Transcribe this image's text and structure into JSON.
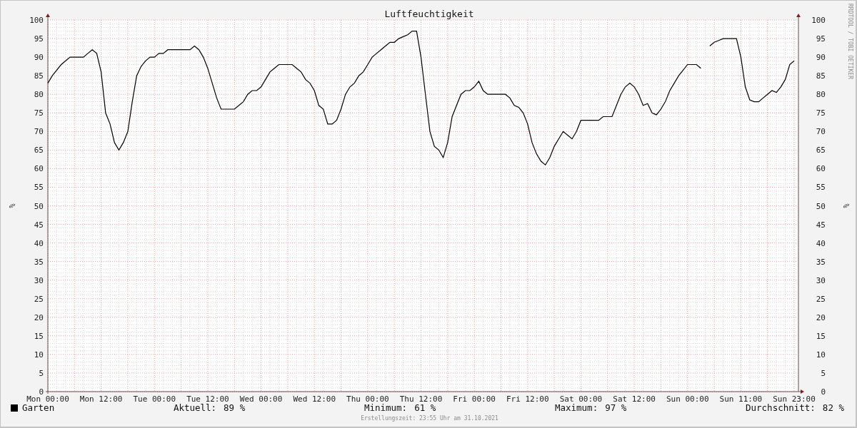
{
  "chart": {
    "credit": "RRDTOOL / TOBI OETIKER",
    "right_axis": {
      "label": "%",
      "ticks": [
        "100",
        "95",
        "90",
        "85",
        "80",
        "75",
        "70",
        "65",
        "60",
        "55",
        "50",
        "45",
        "40",
        "35",
        "30",
        "25",
        "20",
        "15",
        "10",
        "5",
        "0"
      ]
    },
    "chart_data": {
      "type": "line",
      "title": "Luftfeuchtigkeit",
      "ylabel": "%",
      "grid": true,
      "ylim": [
        0,
        100
      ],
      "yticks": [
        0,
        5,
        10,
        15,
        20,
        25,
        30,
        35,
        40,
        45,
        50,
        55,
        60,
        65,
        70,
        75,
        80,
        85,
        90,
        95,
        100
      ],
      "categories": [
        "Mon 00:00",
        null,
        null,
        null,
        null,
        null,
        null,
        null,
        null,
        null,
        null,
        null,
        "Mon 12:00",
        null,
        null,
        null,
        null,
        null,
        null,
        null,
        null,
        null,
        null,
        null,
        "Tue 00:00",
        null,
        null,
        null,
        null,
        null,
        null,
        null,
        null,
        null,
        null,
        null,
        "Tue 12:00",
        null,
        null,
        null,
        null,
        null,
        null,
        null,
        null,
        null,
        null,
        null,
        "Wed 00:00",
        null,
        null,
        null,
        null,
        null,
        null,
        null,
        null,
        null,
        null,
        null,
        "Wed 12:00",
        null,
        null,
        null,
        null,
        null,
        null,
        null,
        null,
        null,
        null,
        null,
        "Thu 00:00",
        null,
        null,
        null,
        null,
        null,
        null,
        null,
        null,
        null,
        null,
        null,
        "Thu 12:00",
        null,
        null,
        null,
        null,
        null,
        null,
        null,
        null,
        null,
        null,
        null,
        "Fri 00:00",
        null,
        null,
        null,
        null,
        null,
        null,
        null,
        null,
        null,
        null,
        null,
        "Fri 12:00",
        null,
        null,
        null,
        null,
        null,
        null,
        null,
        null,
        null,
        null,
        null,
        "Sat 00:00",
        null,
        null,
        null,
        null,
        null,
        null,
        null,
        null,
        null,
        null,
        null,
        "Sat 12:00",
        null,
        null,
        null,
        null,
        null,
        null,
        null,
        null,
        null,
        null,
        null,
        "Sun 00:00",
        null,
        null,
        null,
        null,
        null,
        null,
        null,
        null,
        null,
        null,
        null,
        "Sun 11:00",
        null,
        null,
        null,
        null,
        null,
        null,
        null,
        null,
        null,
        null,
        null,
        "Sun 23:00"
      ],
      "series": [
        {
          "name": "Garten",
          "color": "#000000",
          "values": [
            83,
            85,
            86.5,
            88,
            89,
            90,
            90,
            90,
            90,
            91,
            92,
            91,
            86,
            75,
            72,
            67,
            65,
            67,
            70,
            78,
            85,
            87.5,
            89,
            90,
            90,
            91,
            91,
            92,
            92,
            92,
            92,
            92,
            92,
            93,
            92,
            90,
            87,
            83,
            79,
            76,
            76,
            76,
            76,
            77,
            78,
            80,
            81,
            81,
            82,
            84,
            86,
            87,
            88,
            88,
            88,
            88,
            87,
            86,
            84,
            83,
            81,
            77,
            76,
            72,
            72,
            73,
            76,
            80,
            82,
            83,
            85,
            86,
            88,
            90,
            91,
            92,
            93,
            94,
            94,
            95,
            95.5,
            96,
            97,
            97,
            90,
            80,
            70,
            66,
            65,
            63,
            67,
            74,
            77,
            80,
            81,
            81,
            82,
            83.5,
            81,
            80,
            80,
            80,
            80,
            80,
            79,
            77,
            76.5,
            75,
            72,
            67,
            64,
            62,
            61,
            63,
            66,
            68,
            70,
            69,
            68,
            70,
            73,
            73,
            73,
            73,
            73,
            74,
            74,
            74,
            77,
            80,
            82,
            83,
            82,
            80,
            77,
            77.5,
            75,
            74.5,
            76,
            78,
            81,
            83,
            85,
            86.5,
            88,
            88,
            88,
            87,
            null,
            93,
            94,
            94.5,
            95,
            95,
            95,
            95,
            90,
            82,
            78.5,
            78,
            78,
            79,
            80,
            81,
            80.5,
            82,
            84,
            88,
            89
          ]
        }
      ]
    }
  },
  "legend": {
    "stats": [
      {
        "label": "Aktuell:",
        "value": "89 %"
      },
      {
        "label": "Minimum:",
        "value": "61 %"
      },
      {
        "label": "Maximum:",
        "value": "97 %"
      },
      {
        "label": "Durchschnitt:",
        "value": "82 %"
      }
    ]
  },
  "footer": "Erstellungszeit: 23:55 Uhr am 31.10.2021"
}
